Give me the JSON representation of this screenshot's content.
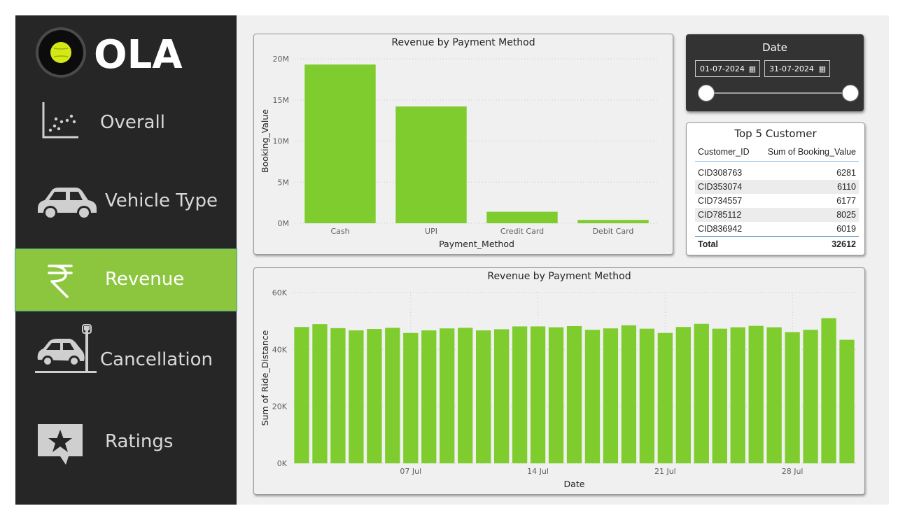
{
  "brand": {
    "name": "OLA"
  },
  "sidebar": {
    "items": [
      {
        "label": "Overall",
        "icon": "scatter-plot-icon",
        "active": false
      },
      {
        "label": "Vehicle Type",
        "icon": "car-icon",
        "active": false
      },
      {
        "label": "Revenue",
        "icon": "rupee-icon",
        "active": true
      },
      {
        "label": "Cancellation",
        "icon": "car-crash-icon",
        "active": false
      },
      {
        "label": "Ratings",
        "icon": "star-rating-icon",
        "active": false
      }
    ]
  },
  "colors": {
    "accent": "#8cc63f",
    "bar": "#7fcc2e",
    "sidebar_bg": "#262626",
    "canvas_bg": "#f0f0f0"
  },
  "date_filter": {
    "title": "Date",
    "start": "01-07-2024",
    "end": "31-07-2024",
    "start_icon": "calendar-icon",
    "end_icon": "calendar-icon"
  },
  "top_customers": {
    "title": "Top 5 Customer",
    "columns": [
      "Customer_ID",
      "Sum of Booking_Value"
    ],
    "rows": [
      {
        "id": "CID308763",
        "value": "6281"
      },
      {
        "id": "CID353074",
        "value": "6110"
      },
      {
        "id": "CID734557",
        "value": "6177"
      },
      {
        "id": "CID785112",
        "value": "8025"
      },
      {
        "id": "CID836942",
        "value": "6019"
      }
    ],
    "total_label": "Total",
    "total_value": "32612"
  },
  "chart_data": [
    {
      "type": "bar",
      "title": "Revenue by Payment Method",
      "xlabel": "Payment_Method",
      "ylabel": "Booking_Value",
      "categories": [
        "Cash",
        "UPI",
        "Credit Card",
        "Debit Card"
      ],
      "values": [
        19300000,
        14200000,
        1400000,
        400000
      ],
      "ylim": [
        0,
        20000000
      ],
      "yticks": [
        0,
        5000000,
        10000000,
        15000000,
        20000000
      ],
      "ytick_labels": [
        "0M",
        "5M",
        "10M",
        "15M",
        "20M"
      ],
      "grid": true
    },
    {
      "type": "bar",
      "title": "Revenue by Payment Method",
      "xlabel": "Date",
      "ylabel": "Sum of Ride_Distance",
      "x": [
        "2024-07-01",
        "2024-07-02",
        "2024-07-03",
        "2024-07-04",
        "2024-07-05",
        "2024-07-06",
        "2024-07-07",
        "2024-07-08",
        "2024-07-09",
        "2024-07-10",
        "2024-07-11",
        "2024-07-12",
        "2024-07-13",
        "2024-07-14",
        "2024-07-15",
        "2024-07-16",
        "2024-07-17",
        "2024-07-18",
        "2024-07-19",
        "2024-07-20",
        "2024-07-21",
        "2024-07-22",
        "2024-07-23",
        "2024-07-24",
        "2024-07-25",
        "2024-07-26",
        "2024-07-27",
        "2024-07-28",
        "2024-07-29",
        "2024-07-30",
        "2024-07-31"
      ],
      "values": [
        47900,
        48900,
        47500,
        46700,
        47200,
        47600,
        45800,
        46700,
        47400,
        47600,
        46700,
        47100,
        48100,
        48100,
        47800,
        48200,
        46900,
        47400,
        48500,
        47300,
        45800,
        47900,
        49000,
        47300,
        47800,
        48300,
        47800,
        46100,
        46900,
        51000,
        43400
      ],
      "ylim": [
        0,
        60000
      ],
      "yticks": [
        0,
        20000,
        40000,
        60000
      ],
      "ytick_labels": [
        "0K",
        "20K",
        "40K",
        "60K"
      ],
      "xticks": [
        {
          "index": 6,
          "label": "07 Jul"
        },
        {
          "index": 13,
          "label": "14 Jul"
        },
        {
          "index": 20,
          "label": "21 Jul"
        },
        {
          "index": 27,
          "label": "28 Jul"
        }
      ],
      "grid": true
    }
  ]
}
